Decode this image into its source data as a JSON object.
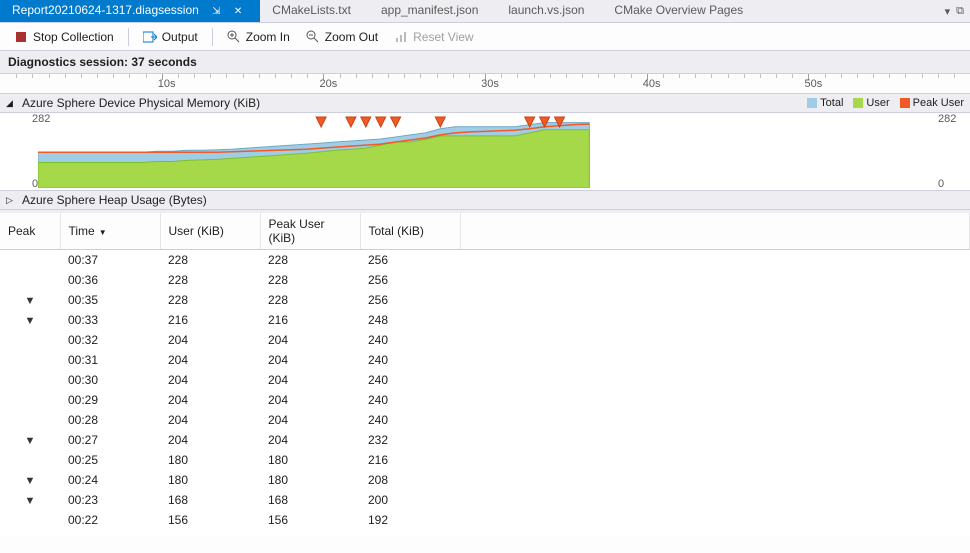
{
  "tabs": {
    "items": [
      {
        "label": "Report20210624-1317.diagsession",
        "active": true
      },
      {
        "label": "CMakeLists.txt",
        "active": false
      },
      {
        "label": "app_manifest.json",
        "active": false
      },
      {
        "label": "launch.vs.json",
        "active": false
      },
      {
        "label": "CMake Overview Pages",
        "active": false
      }
    ]
  },
  "toolbar": {
    "stop": "Stop Collection",
    "output": "Output",
    "zoom_in": "Zoom In",
    "zoom_out": "Zoom Out",
    "reset_view": "Reset View"
  },
  "session": {
    "header": "Diagnostics session: 37 seconds",
    "duration_s": 37
  },
  "ruler": {
    "major": [
      "10s",
      "20s",
      "30s",
      "40s",
      "50s"
    ],
    "max_s": 60
  },
  "panels": {
    "memory": {
      "title": "Azure Sphere Device Physical Memory (KiB)",
      "expanded": true,
      "legend": [
        {
          "name": "Total",
          "color": "#9fcde6"
        },
        {
          "name": "User",
          "color": "#a6d94a"
        },
        {
          "name": "Peak User",
          "color": "#f15a24"
        }
      ],
      "y_max": 282,
      "y_min": 0
    },
    "heap": {
      "title": "Azure Sphere Heap Usage (Bytes)",
      "expanded": false
    }
  },
  "chart_data": {
    "type": "area",
    "title": "Azure Sphere Device Physical Memory (KiB)",
    "xlabel": "seconds",
    "ylabel": "KiB",
    "xlim": [
      0,
      60
    ],
    "ylim": [
      0,
      282
    ],
    "x": [
      0,
      1,
      2,
      3,
      4,
      5,
      6,
      7,
      8,
      9,
      10,
      11,
      12,
      13,
      14,
      15,
      16,
      17,
      18,
      19,
      20,
      21,
      22,
      23,
      24,
      25,
      26,
      27,
      28,
      29,
      30,
      31,
      32,
      33,
      34,
      35,
      36,
      37
    ],
    "series": [
      {
        "name": "Total",
        "values": [
          140,
          140,
          140,
          140,
          140,
          140,
          140,
          140,
          144,
          144,
          148,
          148,
          150,
          152,
          156,
          160,
          164,
          168,
          172,
          176,
          180,
          184,
          188,
          192,
          200,
          208,
          216,
          232,
          240,
          240,
          240,
          240,
          240,
          248,
          256,
          256,
          256,
          256
        ]
      },
      {
        "name": "User",
        "values": [
          100,
          100,
          100,
          100,
          100,
          100,
          100,
          100,
          104,
          104,
          108,
          110,
          112,
          116,
          120,
          124,
          128,
          132,
          136,
          142,
          148,
          152,
          156,
          168,
          180,
          180,
          190,
          204,
          204,
          204,
          204,
          204,
          204,
          216,
          228,
          228,
          228,
          228
        ]
      },
      {
        "name": "Peak User",
        "values": [
          140,
          140,
          140,
          140,
          140,
          140,
          140,
          140,
          140,
          140,
          140,
          140,
          140,
          142,
          144,
          146,
          148,
          150,
          152,
          156,
          160,
          164,
          168,
          172,
          180,
          188,
          196,
          208,
          216,
          220,
          222,
          224,
          226,
          232,
          240,
          244,
          248,
          250
        ]
      }
    ],
    "markers_x": [
      19,
      21,
      22,
      23,
      24,
      27,
      33,
      34,
      35
    ],
    "legend_position": "top-right"
  },
  "table": {
    "columns": {
      "peak": "Peak",
      "time": "Time",
      "user": "User (KiB)",
      "peak_user": "Peak User (KiB)",
      "total": "Total (KiB)"
    },
    "sort": {
      "column": "time",
      "dir": "desc"
    },
    "rows": [
      {
        "peak": false,
        "time": "00:37",
        "user": 228,
        "peak_user": 228,
        "total": 256
      },
      {
        "peak": false,
        "time": "00:36",
        "user": 228,
        "peak_user": 228,
        "total": 256
      },
      {
        "peak": true,
        "time": "00:35",
        "user": 228,
        "peak_user": 228,
        "total": 256
      },
      {
        "peak": true,
        "time": "00:33",
        "user": 216,
        "peak_user": 216,
        "total": 248
      },
      {
        "peak": false,
        "time": "00:32",
        "user": 204,
        "peak_user": 204,
        "total": 240
      },
      {
        "peak": false,
        "time": "00:31",
        "user": 204,
        "peak_user": 204,
        "total": 240
      },
      {
        "peak": false,
        "time": "00:30",
        "user": 204,
        "peak_user": 204,
        "total": 240
      },
      {
        "peak": false,
        "time": "00:29",
        "user": 204,
        "peak_user": 204,
        "total": 240
      },
      {
        "peak": false,
        "time": "00:28",
        "user": 204,
        "peak_user": 204,
        "total": 240
      },
      {
        "peak": true,
        "time": "00:27",
        "user": 204,
        "peak_user": 204,
        "total": 232
      },
      {
        "peak": false,
        "time": "00:25",
        "user": 180,
        "peak_user": 180,
        "total": 216
      },
      {
        "peak": true,
        "time": "00:24",
        "user": 180,
        "peak_user": 180,
        "total": 208
      },
      {
        "peak": true,
        "time": "00:23",
        "user": 168,
        "peak_user": 168,
        "total": 200
      },
      {
        "peak": false,
        "time": "00:22",
        "user": 156,
        "peak_user": 156,
        "total": 192
      }
    ]
  },
  "colors": {
    "total": "#9fcde6",
    "user": "#a6d94a",
    "peak": "#f15a24",
    "tab_active": "#007acc"
  }
}
